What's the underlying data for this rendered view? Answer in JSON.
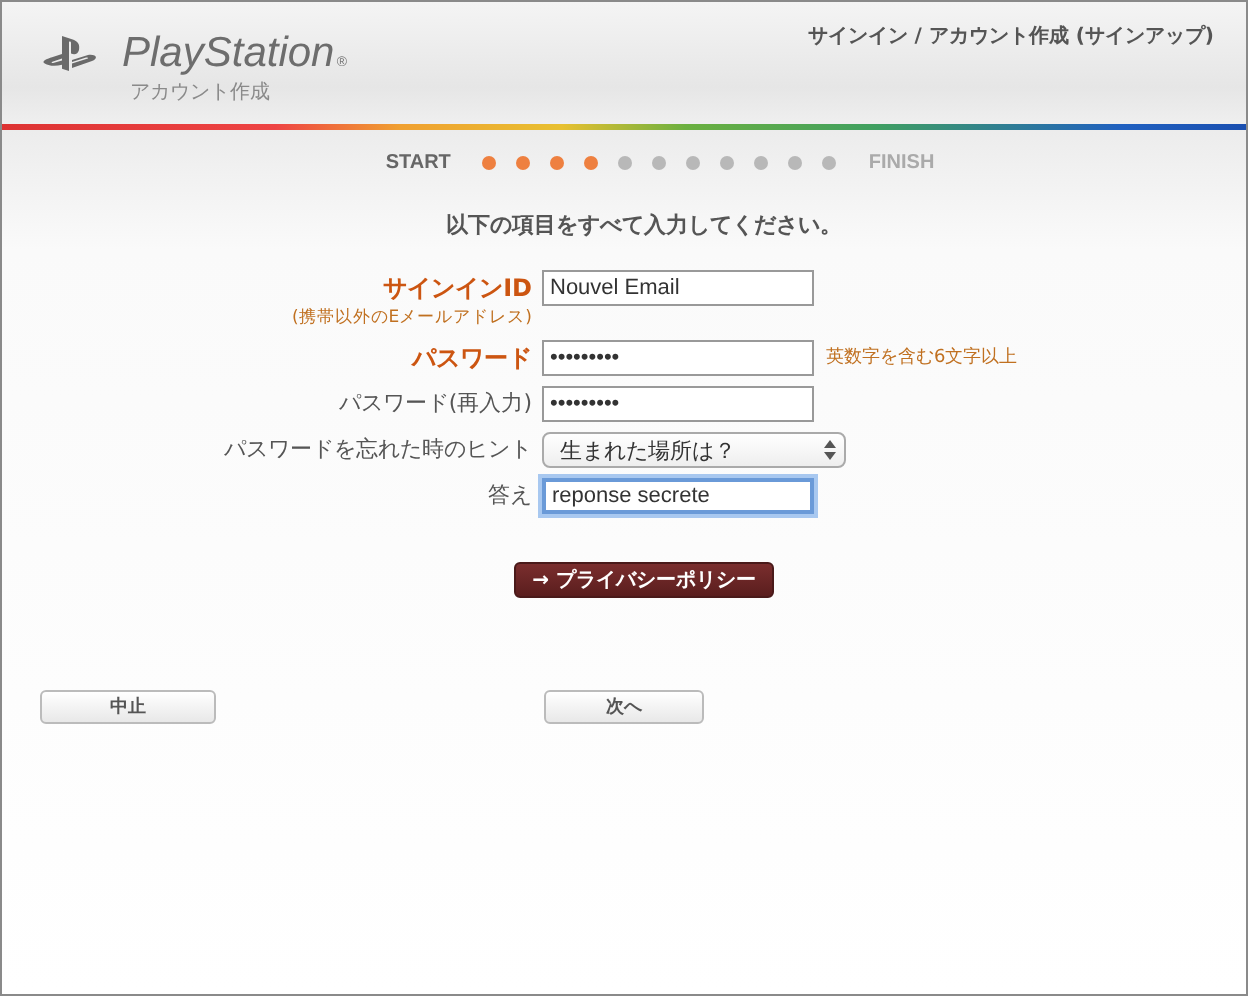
{
  "header": {
    "brand": "PlayStation",
    "registered": "®",
    "subtitle": "アカウント作成",
    "page_title": "サインイン / アカウント作成 (サインアップ)"
  },
  "progress": {
    "start": "START",
    "finish": "FINISH",
    "steps": [
      {
        "completed": true
      },
      {
        "completed": true
      },
      {
        "completed": true
      },
      {
        "completed": true
      },
      {
        "completed": false
      },
      {
        "completed": false
      },
      {
        "completed": false
      },
      {
        "completed": false
      },
      {
        "completed": false
      },
      {
        "completed": false
      },
      {
        "completed": false
      }
    ]
  },
  "instruction": "以下の項目をすべて入力してください。",
  "fields": [
    {
      "kind": "text",
      "label": "サインインID",
      "sublabel": "(携帯以外のEメールアドレス)",
      "required": true,
      "value": "Nouvel Email",
      "focused": false
    },
    {
      "kind": "text",
      "label": "パスワード",
      "required": true,
      "value": "•••••••••",
      "hint": "英数字を含む6文字以上",
      "focused": false
    },
    {
      "kind": "text",
      "label": "パスワード(再入力)",
      "required": false,
      "value": "•••••••••",
      "focused": false
    },
    {
      "kind": "select",
      "label": "パスワードを忘れた時のヒント",
      "required": false,
      "value": "生まれた場所は？",
      "focused": false
    },
    {
      "kind": "text",
      "label": "答え",
      "required": false,
      "value": "reponse secrete",
      "focused": true
    }
  ],
  "privacy_button": "→ プライバシーポリシー",
  "buttons": [
    {
      "label": "中止"
    },
    {
      "label": "次へ"
    }
  ]
}
